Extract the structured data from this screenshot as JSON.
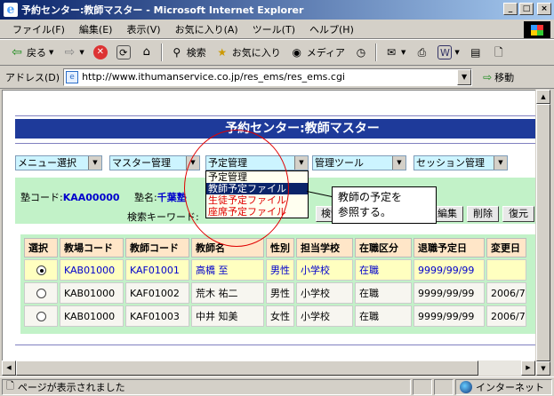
{
  "window": {
    "title": "予約センター:教師マスター - Microsoft Internet Explorer",
    "logo_glyph": "e",
    "buttons": [
      "_",
      "□",
      "×"
    ]
  },
  "menu": [
    "ファイル(F)",
    "編集(E)",
    "表示(V)",
    "お気に入り(A)",
    "ツール(T)",
    "ヘルプ(H)"
  ],
  "toolbar": {
    "back": "戻る",
    "search": "検索",
    "favorites": "お気に入り",
    "media": "メディア"
  },
  "address": {
    "label": "アドレス(D)",
    "url": "http://www.ithumanservice.co.jp/res_ems/res_ems.cgi",
    "go": "移動"
  },
  "page": {
    "heading": "予約センター:教師マスター",
    "selects": {
      "menu": "メニュー選択",
      "master": "マスター管理",
      "reservation": "予定管理",
      "tools": "管理ツール",
      "session": "セッション管理"
    },
    "code_label": "塾コード:",
    "code_value": "KAA00000",
    "jyuku_label": "塾名:",
    "jyuku_value": "千葉塾",
    "search_label": "検索キーワード:",
    "buttons": {
      "search": "検索",
      "edit": "編集",
      "delete": "削除",
      "restore": "復元"
    }
  },
  "dropdown": {
    "items": [
      "予定管理",
      "教師予定ファイル",
      "生徒予定ファイル",
      "座席予定ファイル"
    ]
  },
  "callout": {
    "line1": "教師の予定を",
    "line2": "参照する。"
  },
  "table": {
    "headers": [
      "選択",
      "教場コード",
      "教師コード",
      "教師名",
      "性別",
      "担当学校",
      "在職区分",
      "退職予定日",
      "変更日"
    ],
    "rows": [
      {
        "selected": true,
        "campus": "KAB01000",
        "teacher_code": "KAF01001",
        "name": "高橋 至",
        "gender": "男性",
        "school": "小学校",
        "status": "在職",
        "retire": "9999/99/99",
        "changed": ""
      },
      {
        "selected": false,
        "campus": "KAB01000",
        "teacher_code": "KAF01002",
        "name": "荒木 祐二",
        "gender": "男性",
        "school": "小学校",
        "status": "在職",
        "retire": "9999/99/99",
        "changed": "2006/7"
      },
      {
        "selected": false,
        "campus": "KAB01000",
        "teacher_code": "KAF01003",
        "name": "中井 知美",
        "gender": "女性",
        "school": "小学校",
        "status": "在職",
        "retire": "9999/99/99",
        "changed": "2006/7"
      }
    ]
  },
  "status": {
    "text": "ページが表示されました",
    "zone": "インターネット"
  }
}
